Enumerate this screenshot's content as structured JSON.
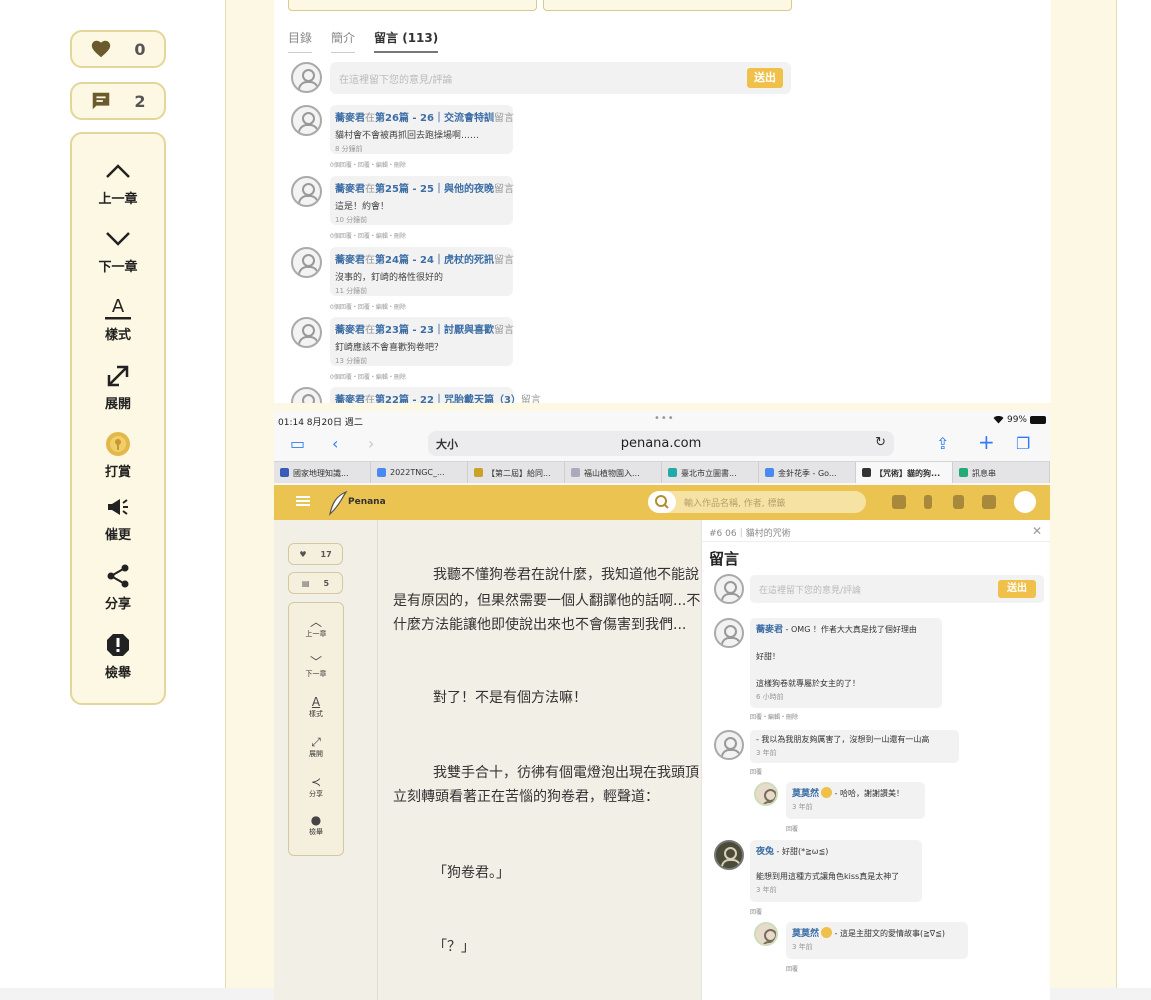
{
  "colors": {
    "accent": "#efc04a",
    "brand_bar": "#ebc350",
    "link": "#3c6ea5",
    "panel_bg": "#fcf8e3"
  },
  "sidebar": {
    "likes": {
      "icon": "heart-icon",
      "count": "0"
    },
    "comments": {
      "icon": "comment-icon",
      "count": "2"
    },
    "tools": [
      {
        "icon": "chevron-up-icon",
        "label": "上一章"
      },
      {
        "icon": "chevron-down-icon",
        "label": "下一章"
      },
      {
        "icon": "font-style-icon",
        "label": "樣式"
      },
      {
        "icon": "expand-icon",
        "label": "展開"
      },
      {
        "icon": "coin-icon",
        "label": "打賞"
      },
      {
        "icon": "megaphone-icon",
        "label": "催更"
      },
      {
        "icon": "share-icon",
        "label": "分享"
      },
      {
        "icon": "report-icon",
        "label": "檢舉"
      }
    ]
  },
  "comments_top": {
    "tabs": [
      "目錄",
      "簡介",
      "留言 (113)"
    ],
    "input_placeholder": "在這裡留下您的意見/評論",
    "send_label": "送出",
    "items": [
      {
        "user": "蕎麥君",
        "pre": "在",
        "chapter": "第26篇 - 26｜交流會特訓",
        "post": "留言",
        "text": "貓村會不會被再抓回去跑操場啊……",
        "time": "8 分鐘前",
        "actions": "0個回覆・回覆・編輯・刪除"
      },
      {
        "user": "蕎麥君",
        "pre": "在",
        "chapter": "第25篇 - 25｜與他的夜晚",
        "post": "留言",
        "text": "這是！約會！",
        "time": "10 分鐘前",
        "actions": "0個回覆・回覆・編輯・刪除"
      },
      {
        "user": "蕎麥君",
        "pre": "在",
        "chapter": "第24篇 - 24｜虎杖的死訊",
        "post": "留言",
        "text": "沒事的，釘崎的格性很好的",
        "time": "11 分鐘前",
        "actions": "0個回覆・回覆・編輯・刪除"
      },
      {
        "user": "蕎麥君",
        "pre": "在",
        "chapter": "第23篇 - 23｜討厭與喜歡",
        "post": "留言",
        "text": "釘崎應該不會喜歡狗卷吧？",
        "time": "13 分鐘前",
        "actions": "0個回覆・回覆・編輯・刪除"
      },
      {
        "user": "蕎麥君",
        "pre": "在",
        "chapter": "第22篇 - 22｜咒胎戴天篇（3）",
        "post": "留言",
        "text": "",
        "time": "",
        "actions": ""
      }
    ]
  },
  "ipad": {
    "status": {
      "time": "01:14  8月20日 週二",
      "dots": "•••",
      "battery": "99%"
    },
    "url_size": "大小",
    "url": "penana.com",
    "tabs": [
      {
        "label": "國家地理知識...",
        "color": "#3a5bb8"
      },
      {
        "label": "2022TNGC_...",
        "color": "#4a8af0"
      },
      {
        "label": "【第二屆】給同...",
        "color": "#c9a227"
      },
      {
        "label": "福山植物園入...",
        "color": "#aab"
      },
      {
        "label": "臺北市立圖書...",
        "color": "#2aa"
      },
      {
        "label": "金針花季 - Go...",
        "color": "#4a8af0"
      },
      {
        "label": "【咒術】貓的狗...",
        "color": "#333",
        "active": true
      },
      {
        "label": "訊息串",
        "color": "#2a7"
      }
    ],
    "brand": "Penana",
    "search_placeholder": "輸入作品名稱, 作者, 標籤",
    "mini_likes": "17",
    "mini_comments": "5",
    "mini_tools": [
      "上一章",
      "下一章",
      "樣式",
      "展開",
      "分享",
      "檢舉"
    ],
    "reader_lines": [
      "我聽不懂狗卷君在說什麼，我知道他不能說",
      "是有原因的，但果然需要一個人翻譯他的話啊...不",
      "什麼方法能讓他即使說出來也不會傷害到我們...",
      "對了！不是有個方法嘛！",
      "我雙手合十，彷彿有個電燈泡出現在我頭頂",
      "立刻轉頭看著正在苦惱的狗卷君，輕聲道：",
      "「狗卷君。」",
      "「？」"
    ],
    "side_panel": {
      "header": "#6 06｜貓村的咒術",
      "title": "留言",
      "input_placeholder": "在這裡留下您的意見/評論",
      "send_label": "送出",
      "c1": {
        "user": "蕎麥君",
        "line1": " - OMG ！作者大大真是找了個好理由",
        "line2": "好甜！",
        "line3": "這樣狗卷就專屬於女主的了！",
        "time": "6 小時前",
        "actions": "回覆・編輯・刪除"
      },
      "c2": {
        "text": "- 我以為我朋友夠厲害了，沒想到一山還有一山高",
        "time": "3 年前",
        "actions": "回覆"
      },
      "c2r": {
        "user": "莫莫然",
        "text": " - 哈哈，謝謝讚美！",
        "time": "3 年前",
        "actions": "回覆"
      },
      "c3": {
        "user": "夜兔",
        "line1": " - 好甜(*≧ω≦)",
        "line2": "能想到用這種方式讓角色kiss真是太神了",
        "time": "3 年前",
        "actions": "回覆"
      },
      "c3r": {
        "user": "莫莫然",
        "text": " - 這是主甜文的愛情故事(≧∇≦)",
        "time": "3 年前",
        "actions": "回覆"
      }
    }
  }
}
